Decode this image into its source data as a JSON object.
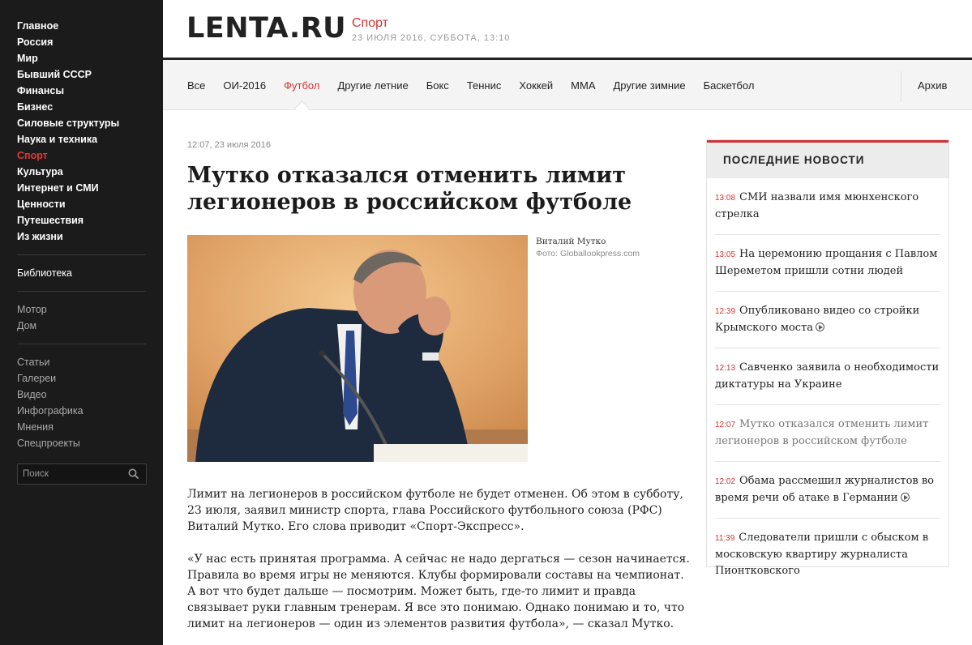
{
  "sidebar": {
    "main": [
      "Главное",
      "Россия",
      "Мир",
      "Бывший СССР",
      "Финансы",
      "Бизнес",
      "Силовые структуры",
      "Наука и техника",
      "Спорт",
      "Культура",
      "Интернет и СМИ",
      "Ценности",
      "Путешествия",
      "Из жизни"
    ],
    "active": "Спорт",
    "library": "Библиотека",
    "projects": [
      "Мотор",
      "Дом"
    ],
    "formats": [
      "Статьи",
      "Галереи",
      "Видео",
      "Инфографика",
      "Мнения",
      "Спецпроекты"
    ],
    "search_placeholder": "Поиск"
  },
  "header": {
    "logo": "LENTA.RU",
    "section": "Спорт",
    "date": "23 ИЮЛЯ 2016, СУББОТА, 13:10"
  },
  "nav": {
    "tabs": [
      "Все",
      "ОИ-2016",
      "Футбол",
      "Другие летние",
      "Бокс",
      "Теннис",
      "Хоккей",
      "MMA",
      "Другие зимние",
      "Баскетбол"
    ],
    "active": "Футбол",
    "archive": "Архив"
  },
  "article": {
    "time": "12:07, 23 июля 2016",
    "title": "Мутко отказался отменить лимит легионеров в российском футболе",
    "photo_caption": "Виталий Мутко",
    "photo_credit": "Фото: Globallookpress.com",
    "paragraph1": "Лимит на легионеров в российском футболе не будет отменен. Об этом в субботу, 23 июля, заявил министр спорта, глава Российского футбольного союза (РФС) Виталий Мутко. Его слова приводит «Спорт-Экспресс».",
    "paragraph2": "«У нас есть принятая программа. А сейчас не надо дергаться — сезон начинается. Правила во время игры не меняются. Клубы формировали составы на чемпионат. А вот что будет дальше — посмотрим. Может быть, где-то лимит и правда связывает руки главным тренерам. Я все это понимаю. Однако понимаю и то, что лимит на легионеров — один из элементов развития футбола», — сказал Мутко."
  },
  "latest": {
    "heading": "ПОСЛЕДНИЕ НОВОСТИ",
    "items": [
      {
        "time": "13:08",
        "text": "СМИ назвали имя мюнхенского стрелка",
        "video": false
      },
      {
        "time": "13:05",
        "text": "На церемонию прощания с Павлом Шереметом пришли сотни людей",
        "video": false
      },
      {
        "time": "12:39",
        "text": "Опубликовано видео со стройки Крымского моста",
        "video": true
      },
      {
        "time": "12:13",
        "text": "Савченко заявила о необходимости диктатуры на Украине",
        "video": false
      },
      {
        "time": "12:07",
        "text": "Мутко отказался отменить лимит легионеров в российском футболе",
        "video": false
      },
      {
        "time": "12:02",
        "text": "Обама рассмешил журналистов во время речи об атаке в Германии",
        "video": true
      },
      {
        "time": "11:39",
        "text": "Следователи пришли с обыском в московскую квартиру журналиста Пионтковского",
        "video": false
      }
    ]
  }
}
